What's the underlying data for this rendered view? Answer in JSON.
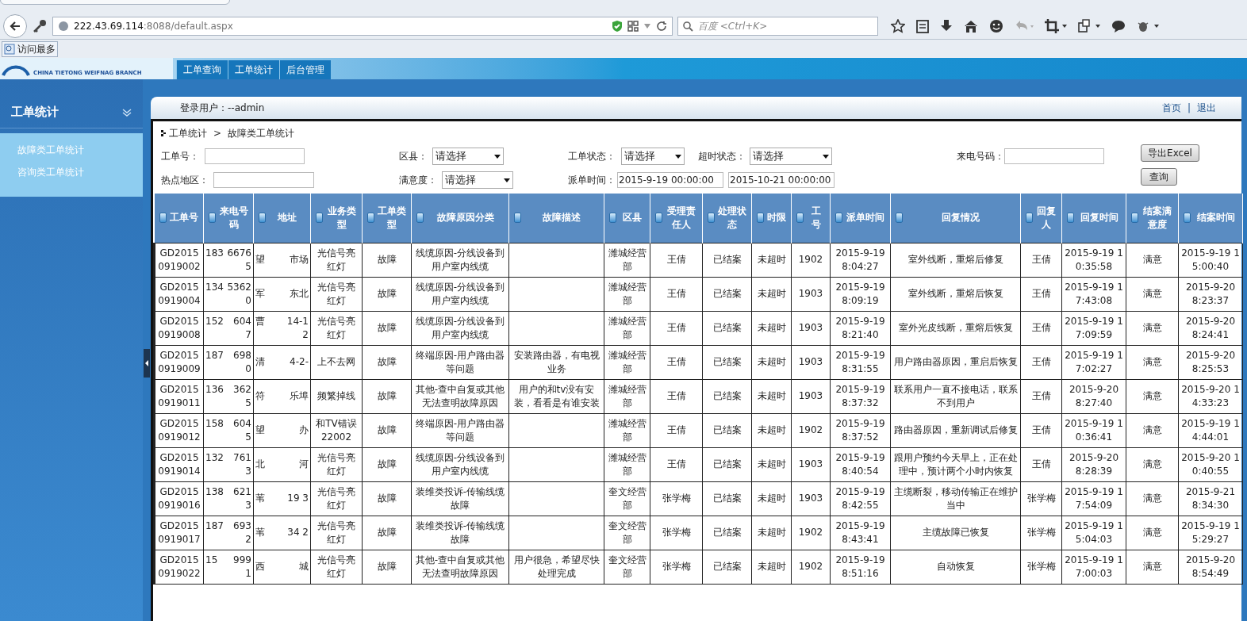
{
  "browser": {
    "url_host": "222.43.69.114",
    "url_rest": ":8088/default.aspx",
    "search_placeholder": "百度 <Ctrl+K>",
    "bookmark": "访问最多"
  },
  "banner": {
    "logo_text": "CHINA TIETONG WEIFNAG BRANCH",
    "nav": [
      "工单查询",
      "工单统计",
      "后台管理"
    ]
  },
  "sidebar": {
    "title": "工单统计",
    "items": [
      "故障类工单统计",
      "咨询类工单统计"
    ]
  },
  "header": {
    "user": "登录用户：--admin",
    "links": [
      "首页",
      "退出"
    ],
    "separator": "|"
  },
  "breadcrumb": [
    "工单统计",
    "故障类工单统计"
  ],
  "breadcrumb_separator": ">",
  "filters": [
    [
      {
        "kind": "text",
        "label": "工单号："
      },
      {
        "kind": "select",
        "label": "区县：",
        "value": "请选择"
      },
      {
        "kind": "select",
        "label": "工单状态：",
        "value": "请选择"
      },
      {
        "kind": "select",
        "label": "超时状态：",
        "value": "请选择"
      },
      {
        "kind": "text",
        "label": "来电号码："
      }
    ],
    [
      {
        "kind": "text",
        "label": "热点地区："
      },
      {
        "kind": "select",
        "label": "满意度：",
        "value": "请选择"
      },
      {
        "kind": "dates",
        "label": "派单时间：",
        "from": "2015-9-19 00:00:00",
        "to": "2015-10-21 00:00:00"
      }
    ]
  ],
  "buttons": [
    "导出Excel",
    "查询"
  ],
  "table": {
    "columns": [
      "工单号",
      "来电号码",
      "地址",
      "业务类型",
      "工单类型",
      "故障原因分类",
      "故障描述",
      "区县",
      "受理责任人",
      "处理状态",
      "时限",
      "工号",
      "派单时间",
      "回复情况",
      "回复人",
      "回复时间",
      "结案满意度",
      "结案时间"
    ],
    "rows": [
      {
        "id": "GD20150919002",
        "phone": [
          "183",
          "6676 5"
        ],
        "address": [
          "望",
          "市场"
        ],
        "business": "光信号亮红灯",
        "type": "故障",
        "cause": "线缆原因-分线设备到用户室内线缆",
        "desc": "",
        "county": "潍城经营部",
        "owner": "王倩",
        "state": "已结案",
        "limit": "未超时",
        "worker": "1902",
        "dispatch": "2015-9-19 8:04:27",
        "reply": "室外线断，重熔后修复",
        "replier": "王倩",
        "reply_time": "2015-9-19 10:35:58",
        "satisfaction": "满意",
        "close_time": "2015-9-19 15:00:40"
      },
      {
        "id": "GD20150919004",
        "phone": [
          "134",
          "5362 0"
        ],
        "address": [
          "军",
          "东北"
        ],
        "business": "光信号亮红灯",
        "type": "故障",
        "cause": "线缆原因-分线设备到用户室内线缆",
        "desc": "",
        "county": "潍城经营部",
        "owner": "王倩",
        "state": "已结案",
        "limit": "未超时",
        "worker": "1903",
        "dispatch": "2015-9-19 8:09:19",
        "reply": "室外线断，重熔后恢复",
        "replier": "王倩",
        "reply_time": "2015-9-19 17:43:08",
        "satisfaction": "满意",
        "close_time": "2015-9-20 8:23:37"
      },
      {
        "id": "GD20150919008",
        "phone": [
          "152",
          "604 7"
        ],
        "address": [
          "曹",
          "14-1 2"
        ],
        "business": "光信号亮红灯",
        "type": "故障",
        "cause": "线缆原因-分线设备到用户室内线缆",
        "desc": "",
        "county": "潍城经营部",
        "owner": "王倩",
        "state": "已结案",
        "limit": "未超时",
        "worker": "1903",
        "dispatch": "2015-9-19 8:21:40",
        "reply": "室外光皮线断，重熔后恢复",
        "replier": "王倩",
        "reply_time": "2015-9-19 17:09:59",
        "satisfaction": "满意",
        "close_time": "2015-9-20 8:24:41"
      },
      {
        "id": "GD20150919009",
        "phone": [
          "187",
          "698 0"
        ],
        "address": [
          "清",
          "4-2-"
        ],
        "business": "上不去网",
        "type": "故障",
        "cause": "终端原因-用户路由器等问题",
        "desc": "安装路由器，有电视业务",
        "county": "潍城经营部",
        "owner": "王倩",
        "state": "已结案",
        "limit": "未超时",
        "worker": "1903",
        "dispatch": "2015-9-19 8:31:55",
        "reply": "用户路由器原因，重启后恢复",
        "replier": "王倩",
        "reply_time": "2015-9-19 17:02:27",
        "satisfaction": "满意",
        "close_time": "2015-9-20 8:25:53"
      },
      {
        "id": "GD20150919011",
        "phone": [
          "136",
          "362 5"
        ],
        "address": [
          "符",
          "乐埠"
        ],
        "business": "频繁掉线",
        "type": "故障",
        "cause": "其他-查中自复或其他无法查明故障原因",
        "desc": "用户的和tv没有安装，看看是有谁安装",
        "county": "潍城经营部",
        "owner": "王倩",
        "state": "已结案",
        "limit": "未超时",
        "worker": "1903",
        "dispatch": "2015-9-19 8:37:32",
        "reply": "联系用户一直不接电话，联系不到用户",
        "replier": "王倩",
        "reply_time": "2015-9-20 8:27:40",
        "satisfaction": "满意",
        "close_time": "2015-9-20 14:33:23"
      },
      {
        "id": "GD20150919012",
        "phone": [
          "158",
          "604 5"
        ],
        "address": [
          "望",
          "办"
        ],
        "business": "和TV错误22002",
        "type": "故障",
        "cause": "终端原因-用户路由器等问题",
        "desc": "",
        "county": "潍城经营部",
        "owner": "王倩",
        "state": "已结案",
        "limit": "未超时",
        "worker": "1902",
        "dispatch": "2015-9-19 8:37:52",
        "reply": "路由器原因，重新调试后修复",
        "replier": "王倩",
        "reply_time": "2015-9-19 10:36:41",
        "satisfaction": "满意",
        "close_time": "2015-9-19 14:44:01"
      },
      {
        "id": "GD20150919014",
        "phone": [
          "132",
          "761 3"
        ],
        "address": [
          "北",
          "河"
        ],
        "business": "光信号亮红灯",
        "type": "故障",
        "cause": "线缆原因-分线设备到用户室内线缆",
        "desc": "",
        "county": "潍城经营部",
        "owner": "王倩",
        "state": "已结案",
        "limit": "未超时",
        "worker": "1903",
        "dispatch": "2015-9-19 8:40:54",
        "reply": "跟用户预约今天早上，正在处理中，预计两个小时内恢复",
        "replier": "王倩",
        "reply_time": "2015-9-20 8:28:39",
        "satisfaction": "满意",
        "close_time": "2015-9-20 10:40:55"
      },
      {
        "id": "GD20150919016",
        "phone": [
          "138",
          "621 3"
        ],
        "address": [
          "苇",
          "19 3"
        ],
        "business": "光信号亮红灯",
        "type": "故障",
        "cause": "装维类投诉-传输线缆故障",
        "desc": "",
        "county": "奎文经营部",
        "owner": "张学梅",
        "state": "已结案",
        "limit": "未超时",
        "worker": "1903",
        "dispatch": "2015-9-19 8:42:55",
        "reply": "主缆断裂，移动传输正在维护当中",
        "replier": "张学梅",
        "reply_time": "2015-9-19 17:54:09",
        "satisfaction": "满意",
        "close_time": "2015-9-21 8:34:30"
      },
      {
        "id": "GD20150919017",
        "phone": [
          "187",
          "693 2"
        ],
        "address": [
          "苇",
          "34 2"
        ],
        "business": "光信号亮红灯",
        "type": "故障",
        "cause": "装维类投诉-传输线缆故障",
        "desc": "",
        "county": "奎文经营部",
        "owner": "张学梅",
        "state": "已结案",
        "limit": "未超时",
        "worker": "1902",
        "dispatch": "2015-9-19 8:43:41",
        "reply": "主缆故障已恢复",
        "replier": "张学梅",
        "reply_time": "2015-9-19 15:04:03",
        "satisfaction": "满意",
        "close_time": "2015-9-19 15:29:27"
      },
      {
        "id": "GD20150919022",
        "phone": [
          "15",
          "999 1"
        ],
        "address": [
          "西",
          "城"
        ],
        "business": "光信号亮红灯",
        "type": "故障",
        "cause": "其他-查中自复或其他无法查明故障原因",
        "desc": "用户很急，希望尽快处理完成",
        "county": "奎文经营部",
        "owner": "张学梅",
        "state": "已结案",
        "limit": "未超时",
        "worker": "1902",
        "dispatch": "2015-9-19 8:51:16",
        "reply": "自动恢复",
        "replier": "张学梅",
        "reply_time": "2015-9-19 17:00:03",
        "satisfaction": "满意",
        "close_time": "2015-9-20 8:54:49"
      }
    ]
  }
}
